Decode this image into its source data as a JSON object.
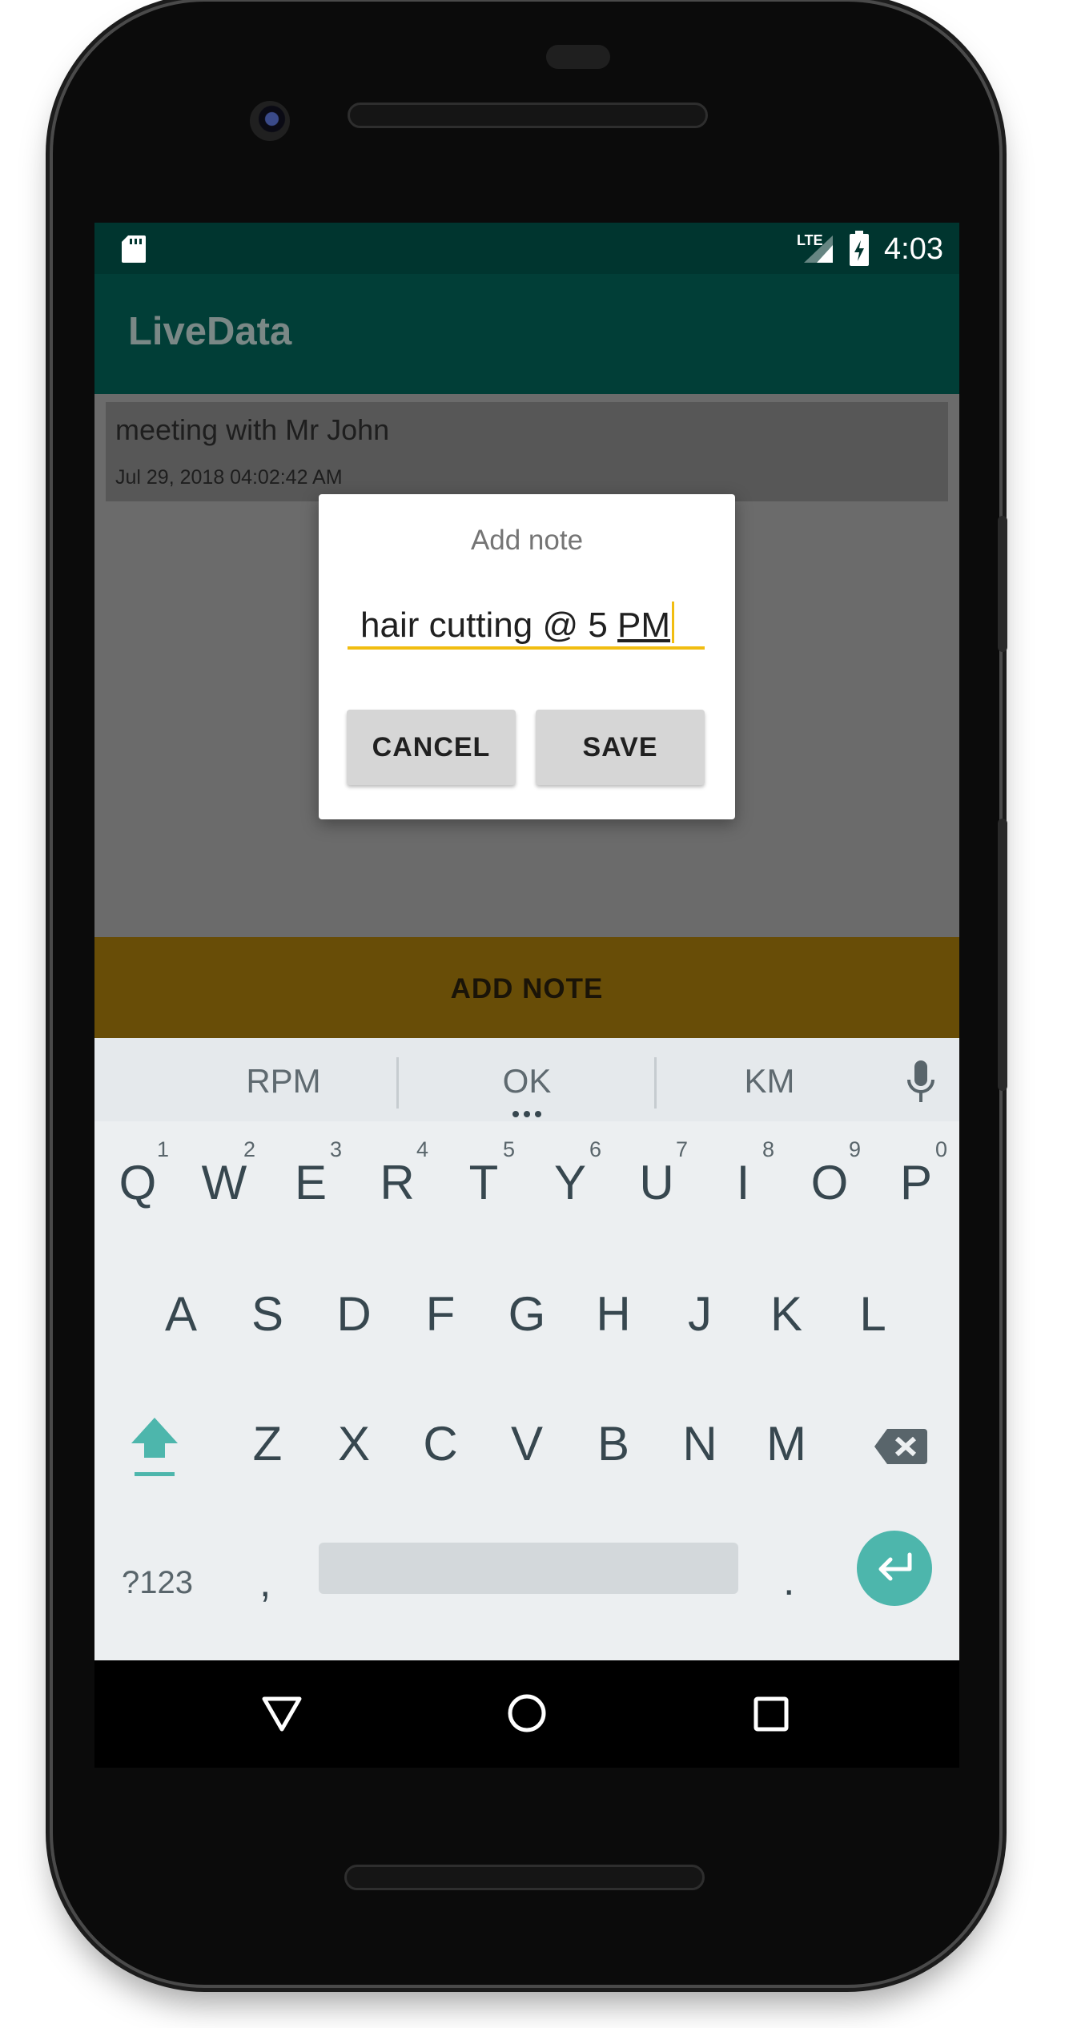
{
  "status_bar": {
    "time": "4:03",
    "network": "LTE",
    "icons": [
      "sd-card-icon",
      "signal-icon",
      "battery-charging-icon"
    ]
  },
  "app_bar": {
    "title": "LiveData"
  },
  "notes": [
    {
      "text": "meeting with Mr John",
      "date": "Jul 29, 2018 04:02:42 AM"
    }
  ],
  "add_note_button": {
    "label": "ADD NOTE"
  },
  "dialog": {
    "title": "Add note",
    "input_value": "hair cutting @ 5 ",
    "input_composing": "PM",
    "cancel_label": "CANCEL",
    "save_label": "SAVE"
  },
  "keyboard": {
    "suggestions": [
      "RPM",
      "OK",
      "KM"
    ],
    "row1": [
      {
        "key": "Q",
        "hint": "1"
      },
      {
        "key": "W",
        "hint": "2"
      },
      {
        "key": "E",
        "hint": "3"
      },
      {
        "key": "R",
        "hint": "4"
      },
      {
        "key": "T",
        "hint": "5"
      },
      {
        "key": "Y",
        "hint": "6"
      },
      {
        "key": "U",
        "hint": "7"
      },
      {
        "key": "I",
        "hint": "8"
      },
      {
        "key": "O",
        "hint": "9"
      },
      {
        "key": "P",
        "hint": "0"
      }
    ],
    "row2": [
      "A",
      "S",
      "D",
      "F",
      "G",
      "H",
      "J",
      "K",
      "L"
    ],
    "row3": [
      "Z",
      "X",
      "C",
      "V",
      "B",
      "N",
      "M"
    ],
    "symbols_label": "?123",
    "comma_label": ",",
    "period_label": ".",
    "accent_color": "#4db6ac"
  },
  "colors": {
    "status_bar": "#00352f",
    "app_bar": "#013e37",
    "input_underline": "#f1bd11",
    "add_note_bg": "#684d07"
  }
}
